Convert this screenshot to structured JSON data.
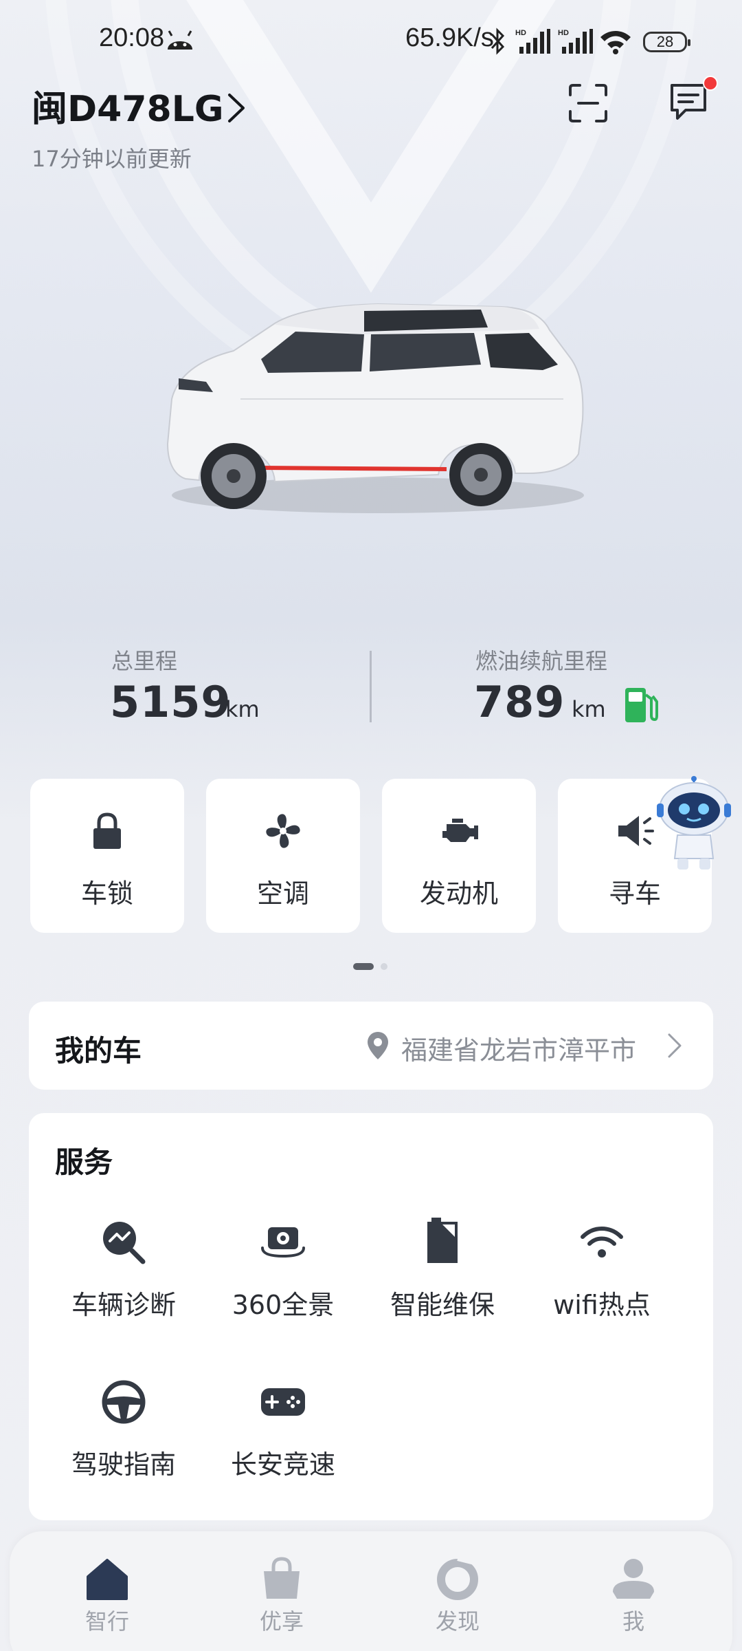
{
  "status_bar": {
    "time": "20:08",
    "net_speed": "65.9K/s",
    "battery": "28",
    "icons": [
      "android-icon",
      "bluetooth-icon",
      "signal-hd-icon",
      "signal-hd-icon",
      "wifi-icon",
      "battery-icon"
    ]
  },
  "header": {
    "plate": "闽D478LG",
    "updated": "17分钟以前更新"
  },
  "stats": {
    "total_label": "总里程",
    "total_value": "5159",
    "total_unit": "km",
    "range_label": "燃油续航里程",
    "range_value": "789",
    "range_unit": "km"
  },
  "quick_controls": [
    {
      "label": "车锁",
      "icon": "lock-icon"
    },
    {
      "label": "空调",
      "icon": "fan-icon"
    },
    {
      "label": "发动机",
      "icon": "engine-icon"
    },
    {
      "label": "寻车",
      "icon": "horn-icon"
    }
  ],
  "pager": {
    "pages": 2,
    "active": 1
  },
  "my_car": {
    "title": "我的车",
    "location": "福建省龙岩市漳平市"
  },
  "services": {
    "title": "服务",
    "items": [
      {
        "label": "车辆诊断",
        "icon": "diagnosis-icon"
      },
      {
        "label": "360全景",
        "icon": "camera-icon"
      },
      {
        "label": "智能维保",
        "icon": "maintenance-icon"
      },
      {
        "label": "wifi热点",
        "icon": "wifi-icon"
      },
      {
        "label": "驾驶指南",
        "icon": "steering-wheel-icon"
      },
      {
        "label": "长安竞速",
        "icon": "gamepad-icon"
      }
    ]
  },
  "bottom_nav": [
    {
      "label": "智行",
      "icon": "home-icon",
      "active": true
    },
    {
      "label": "优享",
      "icon": "bag-icon",
      "active": false
    },
    {
      "label": "发现",
      "icon": "discover-icon",
      "active": false
    },
    {
      "label": "我",
      "icon": "profile-icon",
      "active": false
    }
  ],
  "colors": {
    "fuel_green": "#2fb35a",
    "notification_red": "#f2393a",
    "icon_dark": "#343a44"
  }
}
